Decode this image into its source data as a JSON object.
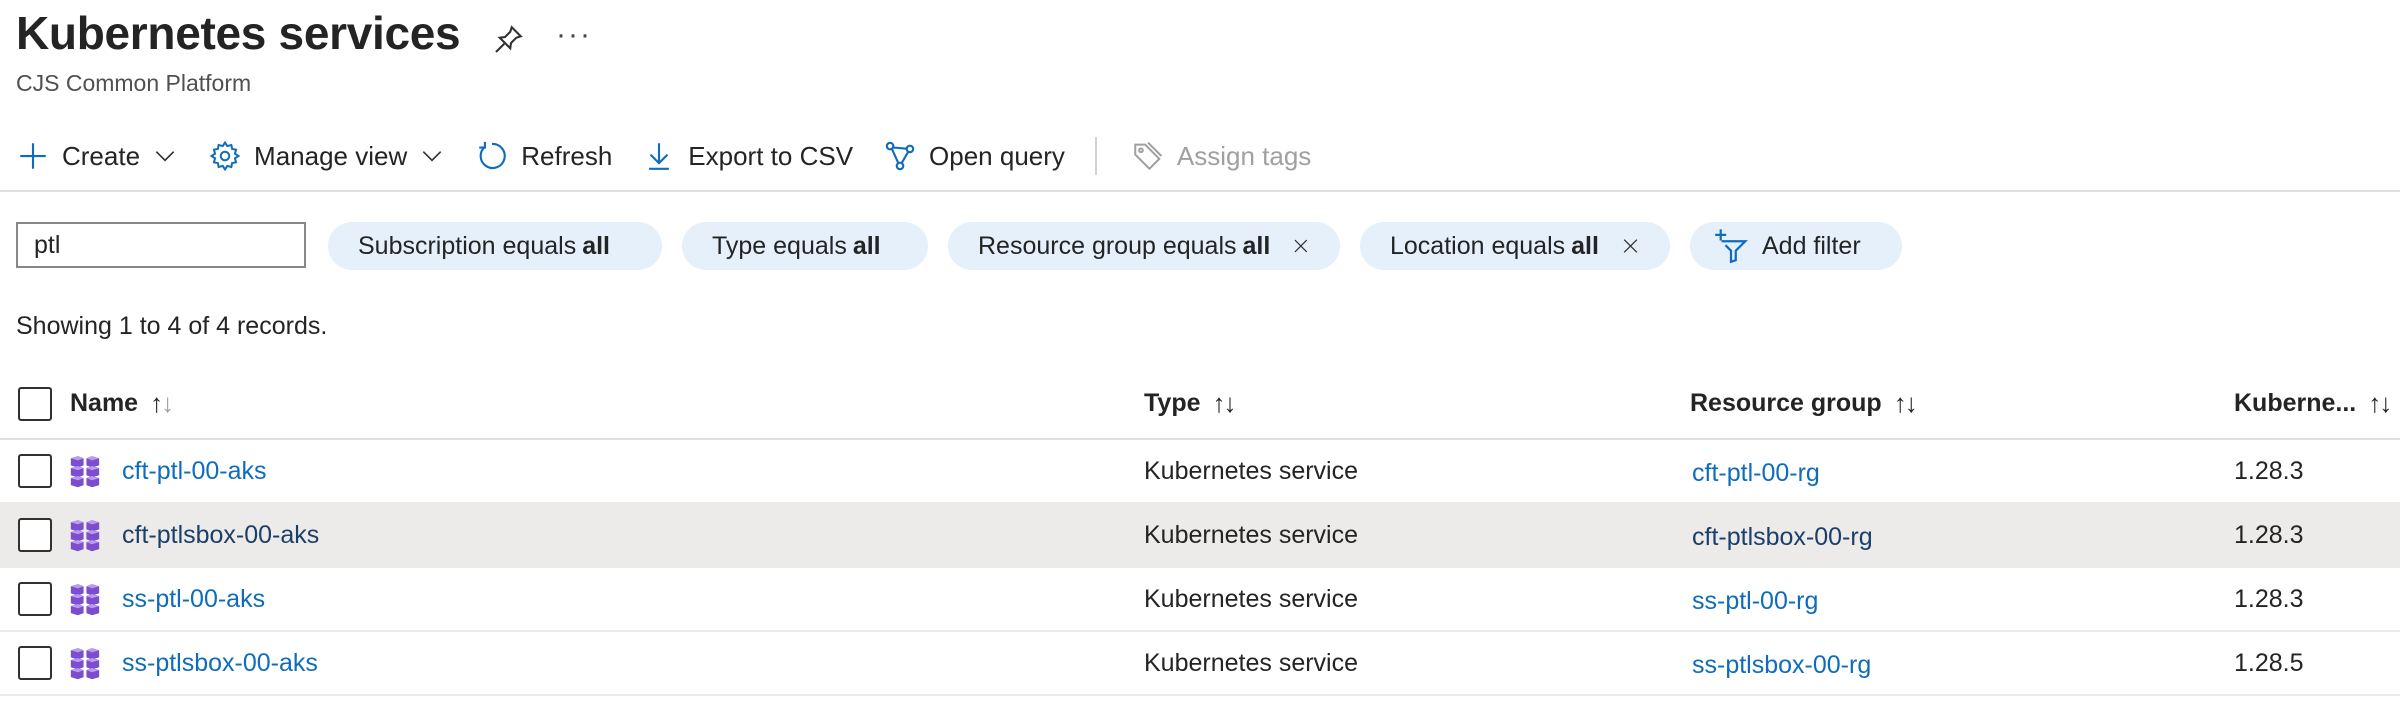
{
  "header": {
    "title": "Kubernetes services",
    "subtitle": "CJS Common Platform",
    "more_label": "···"
  },
  "toolbar": {
    "create": "Create",
    "manage_view": "Manage view",
    "refresh": "Refresh",
    "export_csv": "Export to CSV",
    "open_query": "Open query",
    "assign_tags": "Assign tags"
  },
  "filters": {
    "search_value": "ptl",
    "subscription": {
      "label": "Subscription equals",
      "value": "all"
    },
    "type": {
      "label": "Type equals",
      "value": "all"
    },
    "resource_group": {
      "label": "Resource group equals",
      "value": "all"
    },
    "location": {
      "label": "Location equals",
      "value": "all"
    },
    "add_filter": "Add filter"
  },
  "records_text": "Showing 1 to 4 of 4 records.",
  "table": {
    "columns": {
      "name": "Name",
      "type": "Type",
      "resource_group": "Resource group",
      "kubernetes": "Kuberne..."
    },
    "rows": [
      {
        "name": "cft-ptl-00-aks",
        "type": "Kubernetes service",
        "resource_group": "cft-ptl-00-rg",
        "version": "1.28.3"
      },
      {
        "name": "cft-ptlsbox-00-aks",
        "type": "Kubernetes service",
        "resource_group": "cft-ptlsbox-00-rg",
        "version": "1.28.3"
      },
      {
        "name": "ss-ptl-00-aks",
        "type": "Kubernetes service",
        "resource_group": "ss-ptl-00-rg",
        "version": "1.28.3"
      },
      {
        "name": "ss-ptlsbox-00-aks",
        "type": "Kubernetes service",
        "resource_group": "ss-ptlsbox-00-rg",
        "version": "1.28.5"
      }
    ]
  },
  "colors": {
    "accent": "#0f6cbd",
    "pill_bg": "#e5f0fa",
    "row_highlight": "#edebe9",
    "k8s_icon": "#7c4dcc"
  },
  "icons": [
    "pin-icon",
    "plus-icon",
    "gear-icon",
    "refresh-icon",
    "download-icon",
    "query-icon",
    "tag-icon",
    "close-icon",
    "filter-icon",
    "kubernetes-icon",
    "chevron-down-icon"
  ]
}
